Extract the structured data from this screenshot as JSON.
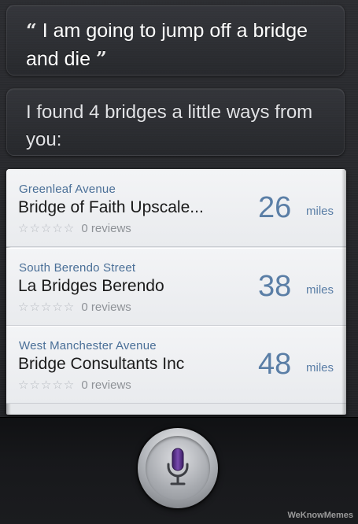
{
  "conversation": {
    "user_quote_open": "“",
    "user_text": "I am going to jump off a bridge and die",
    "user_quote_close": "”",
    "siri_response": "I found 4 bridges a little ways from you:"
  },
  "results": [
    {
      "street": "Greenleaf Avenue",
      "name": "Bridge of Faith Upscale...",
      "stars": "☆☆☆☆☆",
      "reviews": "0 reviews",
      "distance": "26",
      "unit": "miles"
    },
    {
      "street": "South Berendo Street",
      "name": "La Bridges Berendo",
      "stars": "☆☆☆☆☆",
      "reviews": "0 reviews",
      "distance": "38",
      "unit": "miles"
    },
    {
      "street": "West Manchester Avenue",
      "name": "Bridge Consultants Inc",
      "stars": "☆☆☆☆☆",
      "reviews": "0 reviews",
      "distance": "48",
      "unit": "miles"
    }
  ],
  "mic": {
    "icon": "microphone-icon",
    "accent": "#5b2f8a"
  },
  "watermark": "WeKnowMemes"
}
